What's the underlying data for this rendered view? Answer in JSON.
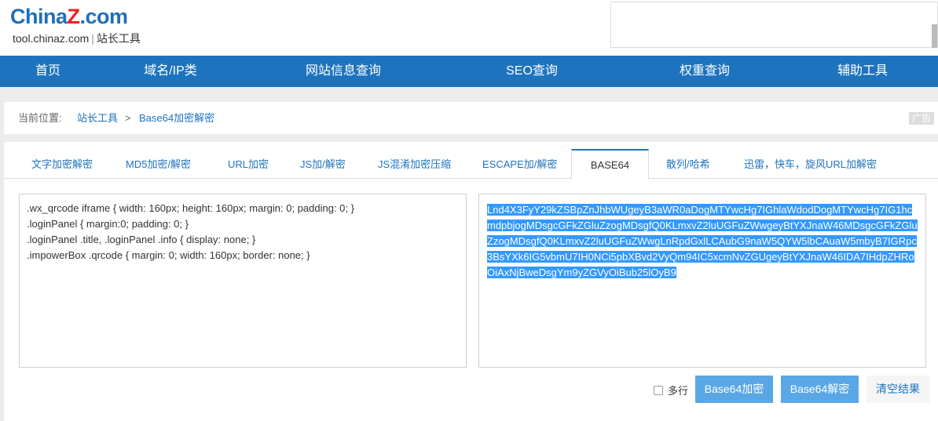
{
  "header": {
    "logo_china": "China",
    "logo_z": "Z",
    "logo_com": ".com",
    "logo_site": "tool.chinaz.com",
    "logo_sep": "|",
    "logo_cn": "站长工具"
  },
  "nav": {
    "items": [
      "首页",
      "域名/IP类",
      "网站信息查询",
      "SEO查询",
      "权重查询",
      "辅助工具"
    ]
  },
  "breadcrumb": {
    "label": "当前位置:",
    "root": "站长工具",
    "arrow": ">",
    "current": "Base64加密解密",
    "ad": "广告"
  },
  "tabs": [
    {
      "label": "文字加密解密"
    },
    {
      "label": "MD5加密/解密"
    },
    {
      "label": "URL加密"
    },
    {
      "label": "JS加/解密"
    },
    {
      "label": "JS混淆加密压缩"
    },
    {
      "label": "ESCAPE加/解密"
    },
    {
      "label": "BASE64"
    },
    {
      "label": "散列/哈希"
    },
    {
      "label": "迅雷，快车，旋风URL加解密"
    }
  ],
  "input": {
    "lines": [
      ".wx_qrcode iframe { width: 160px; height: 160px; margin: 0; padding: 0; }",
      ".loginPanel { margin:0; padding: 0; }",
      ".loginPanel .title, .loginPanel .info { display: none; }",
      ".impowerBox .qrcode { margin: 0; width: 160px; border: none; }"
    ]
  },
  "output": {
    "text": "Lnd4X3FyY29kZSBpZnJhbWUgeyB3aWR0aDogMTYwcHg7IGhlaWdodDogMTYwcHg7IG1hcmdpbjogMDsgcGFkZGluZzogMDsgfQ0KLmxvZ2luUGFuZWwgeyBtYXJnaW46MDsgcGFkZGluZzogMDsgfQ0KLmxvZ2luUGFuZWwgLnRpdGxlLCAubG9naW5QYW5lbCAuaW5mbyB7IGRpc3BsYXk6IG5vbmU7IH0NCi5pbXBvd2VyQm94IC5xcmNvZGUgeyBtYXJnaW46IDA7IHdpZHRoOiAxNjBweDsgYm9yZGVyOiBub25lOyB9"
  },
  "actions": {
    "multiline_label": "多行",
    "multiline_checked": false,
    "encode_label": "Base64加密",
    "decode_label": "Base64解密",
    "clear_label": "清空结果"
  },
  "colors": {
    "nav_bg": "#1e73be",
    "link": "#1e73be",
    "button_bg": "#5aa7e6",
    "selection": "#3399ff"
  }
}
